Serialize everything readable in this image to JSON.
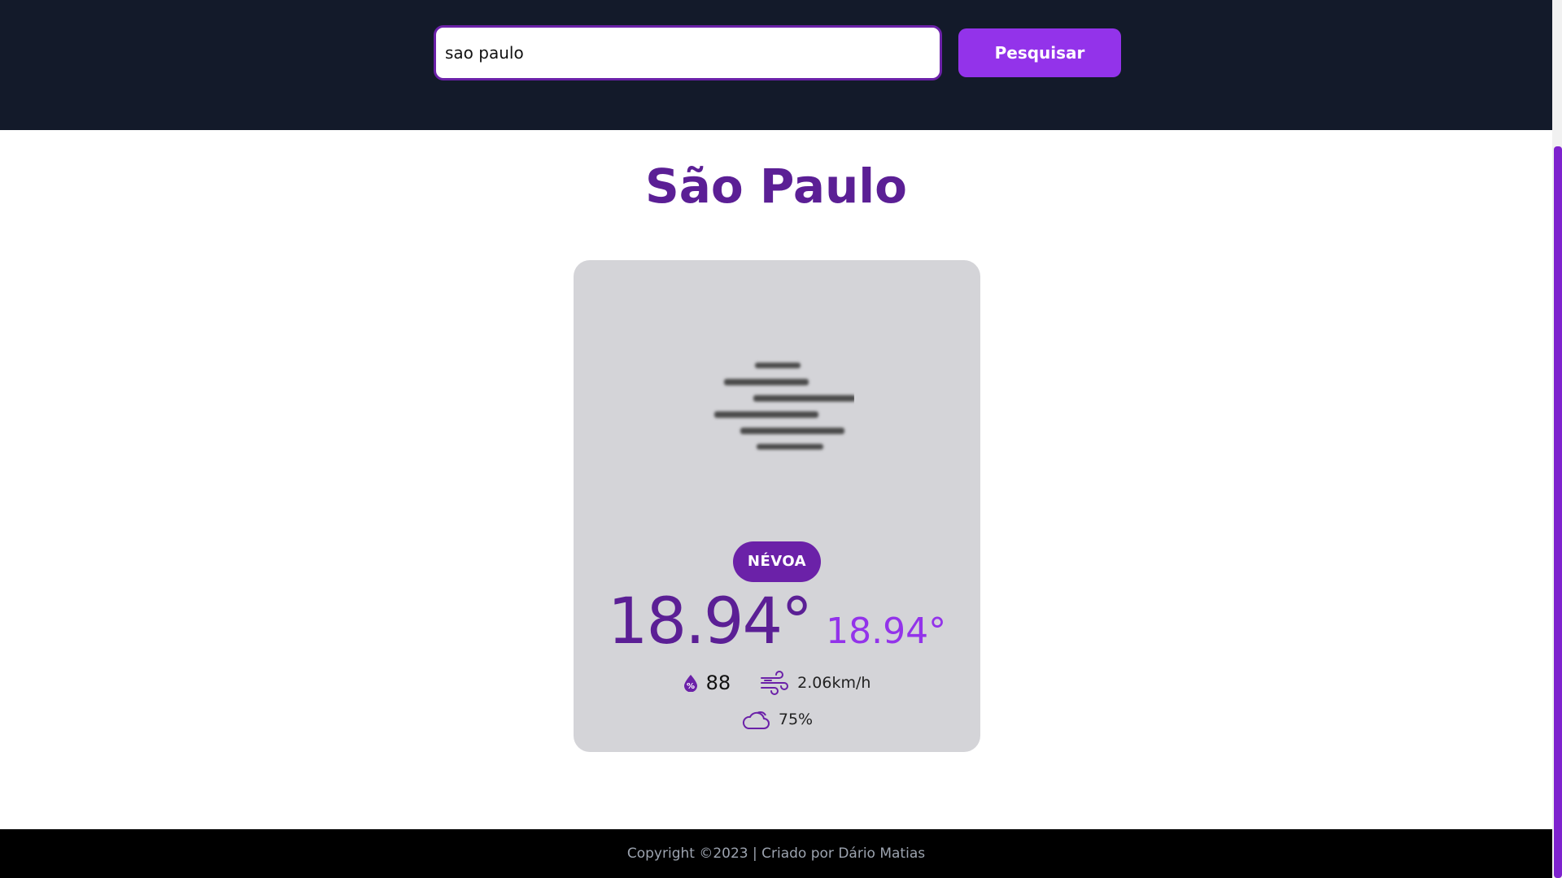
{
  "search": {
    "value": "sao paulo",
    "button_label": "Pesquisar"
  },
  "weather": {
    "city": "São Paulo",
    "condition": "NÉVOA",
    "icon": "mist-icon",
    "temperature": "18.94°",
    "feels_like": "18.94°",
    "humidity": "88",
    "wind": "2.06km/h",
    "clouds": "75%"
  },
  "footer": {
    "text": "Copyright ©2023 | Criado por Dário Matias"
  },
  "colors": {
    "header_bg": "#131a2a",
    "accent": "#9333ea",
    "accent_dark": "#5b1f95",
    "card_bg": "#d4d4d8",
    "footer_bg": "#000000"
  }
}
